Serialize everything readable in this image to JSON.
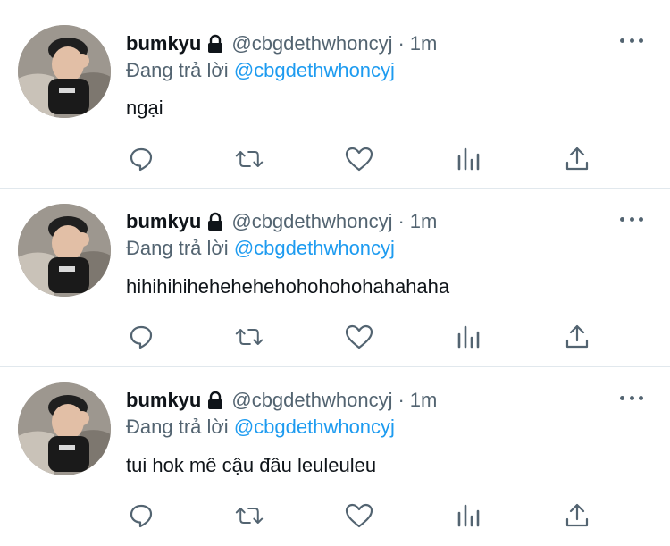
{
  "tweets": [
    {
      "name": "bumkyu",
      "handle": "@cbgdethwhoncyj",
      "separator": "·",
      "time": "1m",
      "reply_prefix": "Đang trả lời",
      "reply_to": "@cbgdethwhoncyj",
      "text": "ngại"
    },
    {
      "name": "bumkyu",
      "handle": "@cbgdethwhoncyj",
      "separator": "·",
      "time": "1m",
      "reply_prefix": "Đang trả lời",
      "reply_to": "@cbgdethwhoncyj",
      "text": "hihihihihehehehehohohohohahahaha"
    },
    {
      "name": "bumkyu",
      "handle": "@cbgdethwhoncyj",
      "separator": "·",
      "time": "1m",
      "reply_prefix": "Đang trả lời",
      "reply_to": "@cbgdethwhoncyj",
      "text": "tui hok mê cậu đâu leuleuleu"
    }
  ],
  "icons": {
    "lock": "lock-icon",
    "more": "more-icon",
    "reply": "reply-icon",
    "retweet": "retweet-icon",
    "like": "heart-icon",
    "stats": "bar-chart-icon",
    "share": "share-icon"
  },
  "colors": {
    "text": "#0f1419",
    "secondary": "#536471",
    "link": "#1d9bf0",
    "divider": "#e1e8ed"
  }
}
